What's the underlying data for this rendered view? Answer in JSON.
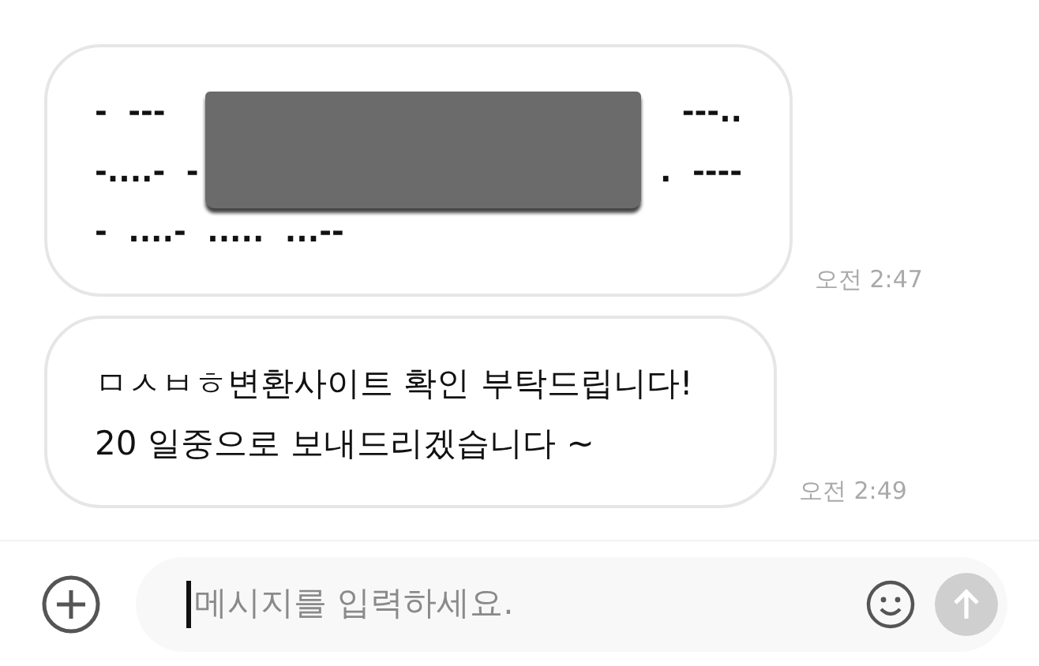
{
  "messages": [
    {
      "kind": "morse",
      "redacted": true,
      "lines": [
        {
          "left": "-  ---",
          "right": "---.."
        },
        {
          "left": "-....-  -",
          "right": ".  ----"
        },
        {
          "left": "-  ....-  .....  ...--"
        }
      ],
      "time": "오전 2:47"
    },
    {
      "kind": "text",
      "lines": [
        {
          "left": "ㅁㅅㅂㅎ변환사이트 확인 부탁드립니다!"
        },
        {
          "left": "20 일중으로 보내드리겠습니다 ~"
        }
      ],
      "time": "오전 2:49"
    }
  ],
  "composer": {
    "placeholder": "메시지를 입력하세요."
  }
}
